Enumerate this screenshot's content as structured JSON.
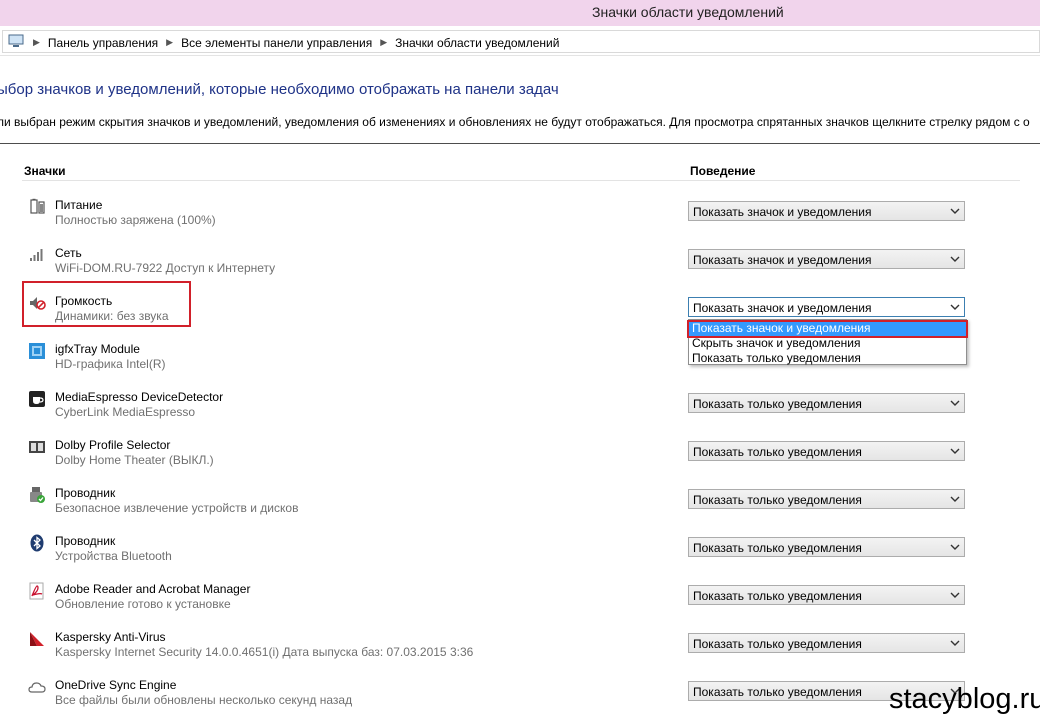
{
  "window": {
    "title": "Значки области уведомлений"
  },
  "breadcrumb": [
    "Панель управления",
    "Все элементы панели управления",
    "Значки области уведомлений"
  ],
  "heading": "ыбор значков и уведомлений, которые необходимо отображать на панели задач",
  "description": "ли выбран режим скрытия значков и уведомлений, уведомления об изменениях и обновлениях не будут отображаться. Для просмотра спрятанных значков щелкните стрелку рядом с о",
  "columns": {
    "icons": "Значки",
    "behavior": "Поведение"
  },
  "rows": [
    {
      "name": "Питание",
      "sub": "Полностью заряжена (100%)",
      "behavior": "Показать значок и уведомления",
      "icon": "battery-icon"
    },
    {
      "name": "Сеть",
      "sub": "WiFi-DOM.RU-7922 Доступ к Интернету",
      "behavior": "Показать значок и уведомления",
      "icon": "wifi-signal-icon"
    },
    {
      "name": "Громкость",
      "sub": "Динамики: без звука",
      "behavior": "Показать значок и уведомления",
      "icon": "speaker-muted-icon"
    },
    {
      "name": "igfxTray Module",
      "sub": "HD-графика Intel(R)",
      "behavior": "",
      "icon": "intel-graphics-icon"
    },
    {
      "name": "MediaEspresso DeviceDetector",
      "sub": "CyberLink MediaEspresso",
      "behavior": "Показать только уведомления",
      "icon": "mediaespresso-icon"
    },
    {
      "name": "Dolby Profile Selector",
      "sub": "Dolby Home Theater (ВЫКЛ.)",
      "behavior": "Показать только уведомления",
      "icon": "dolby-icon"
    },
    {
      "name": "Проводник",
      "sub": "Безопасное извлечение устройств и дисков",
      "behavior": "Показать только уведомления",
      "icon": "usb-eject-icon"
    },
    {
      "name": "Проводник",
      "sub": "Устройства Bluetooth",
      "behavior": "Показать только уведомления",
      "icon": "bluetooth-icon"
    },
    {
      "name": "Adobe Reader and Acrobat Manager",
      "sub": "Обновление готово к установке",
      "behavior": "Показать только уведомления",
      "icon": "adobe-icon"
    },
    {
      "name": "Kaspersky Anti-Virus",
      "sub": "Kaspersky Internet Security 14.0.0.4651(i) Дата выпуска баз: 07.03.2015 3:36",
      "behavior": "Показать только уведомления",
      "icon": "kaspersky-icon"
    },
    {
      "name": "OneDrive Sync Engine",
      "sub": "Все файлы были обновлены несколько секунд назад",
      "behavior": "Показать только уведомления",
      "icon": "onedrive-cloud-icon"
    }
  ],
  "dropdown": {
    "options": [
      "Показать значок и уведомления",
      "Скрыть значок и уведомления",
      "Показать только уведомления"
    ],
    "selected_index": 0
  },
  "watermark": "stacyblog.ru",
  "colors": {
    "title_bar": "#f1d4ec",
    "heading": "#1e3287",
    "highlight_red": "#d1202a",
    "selection_blue": "#3399ff"
  }
}
